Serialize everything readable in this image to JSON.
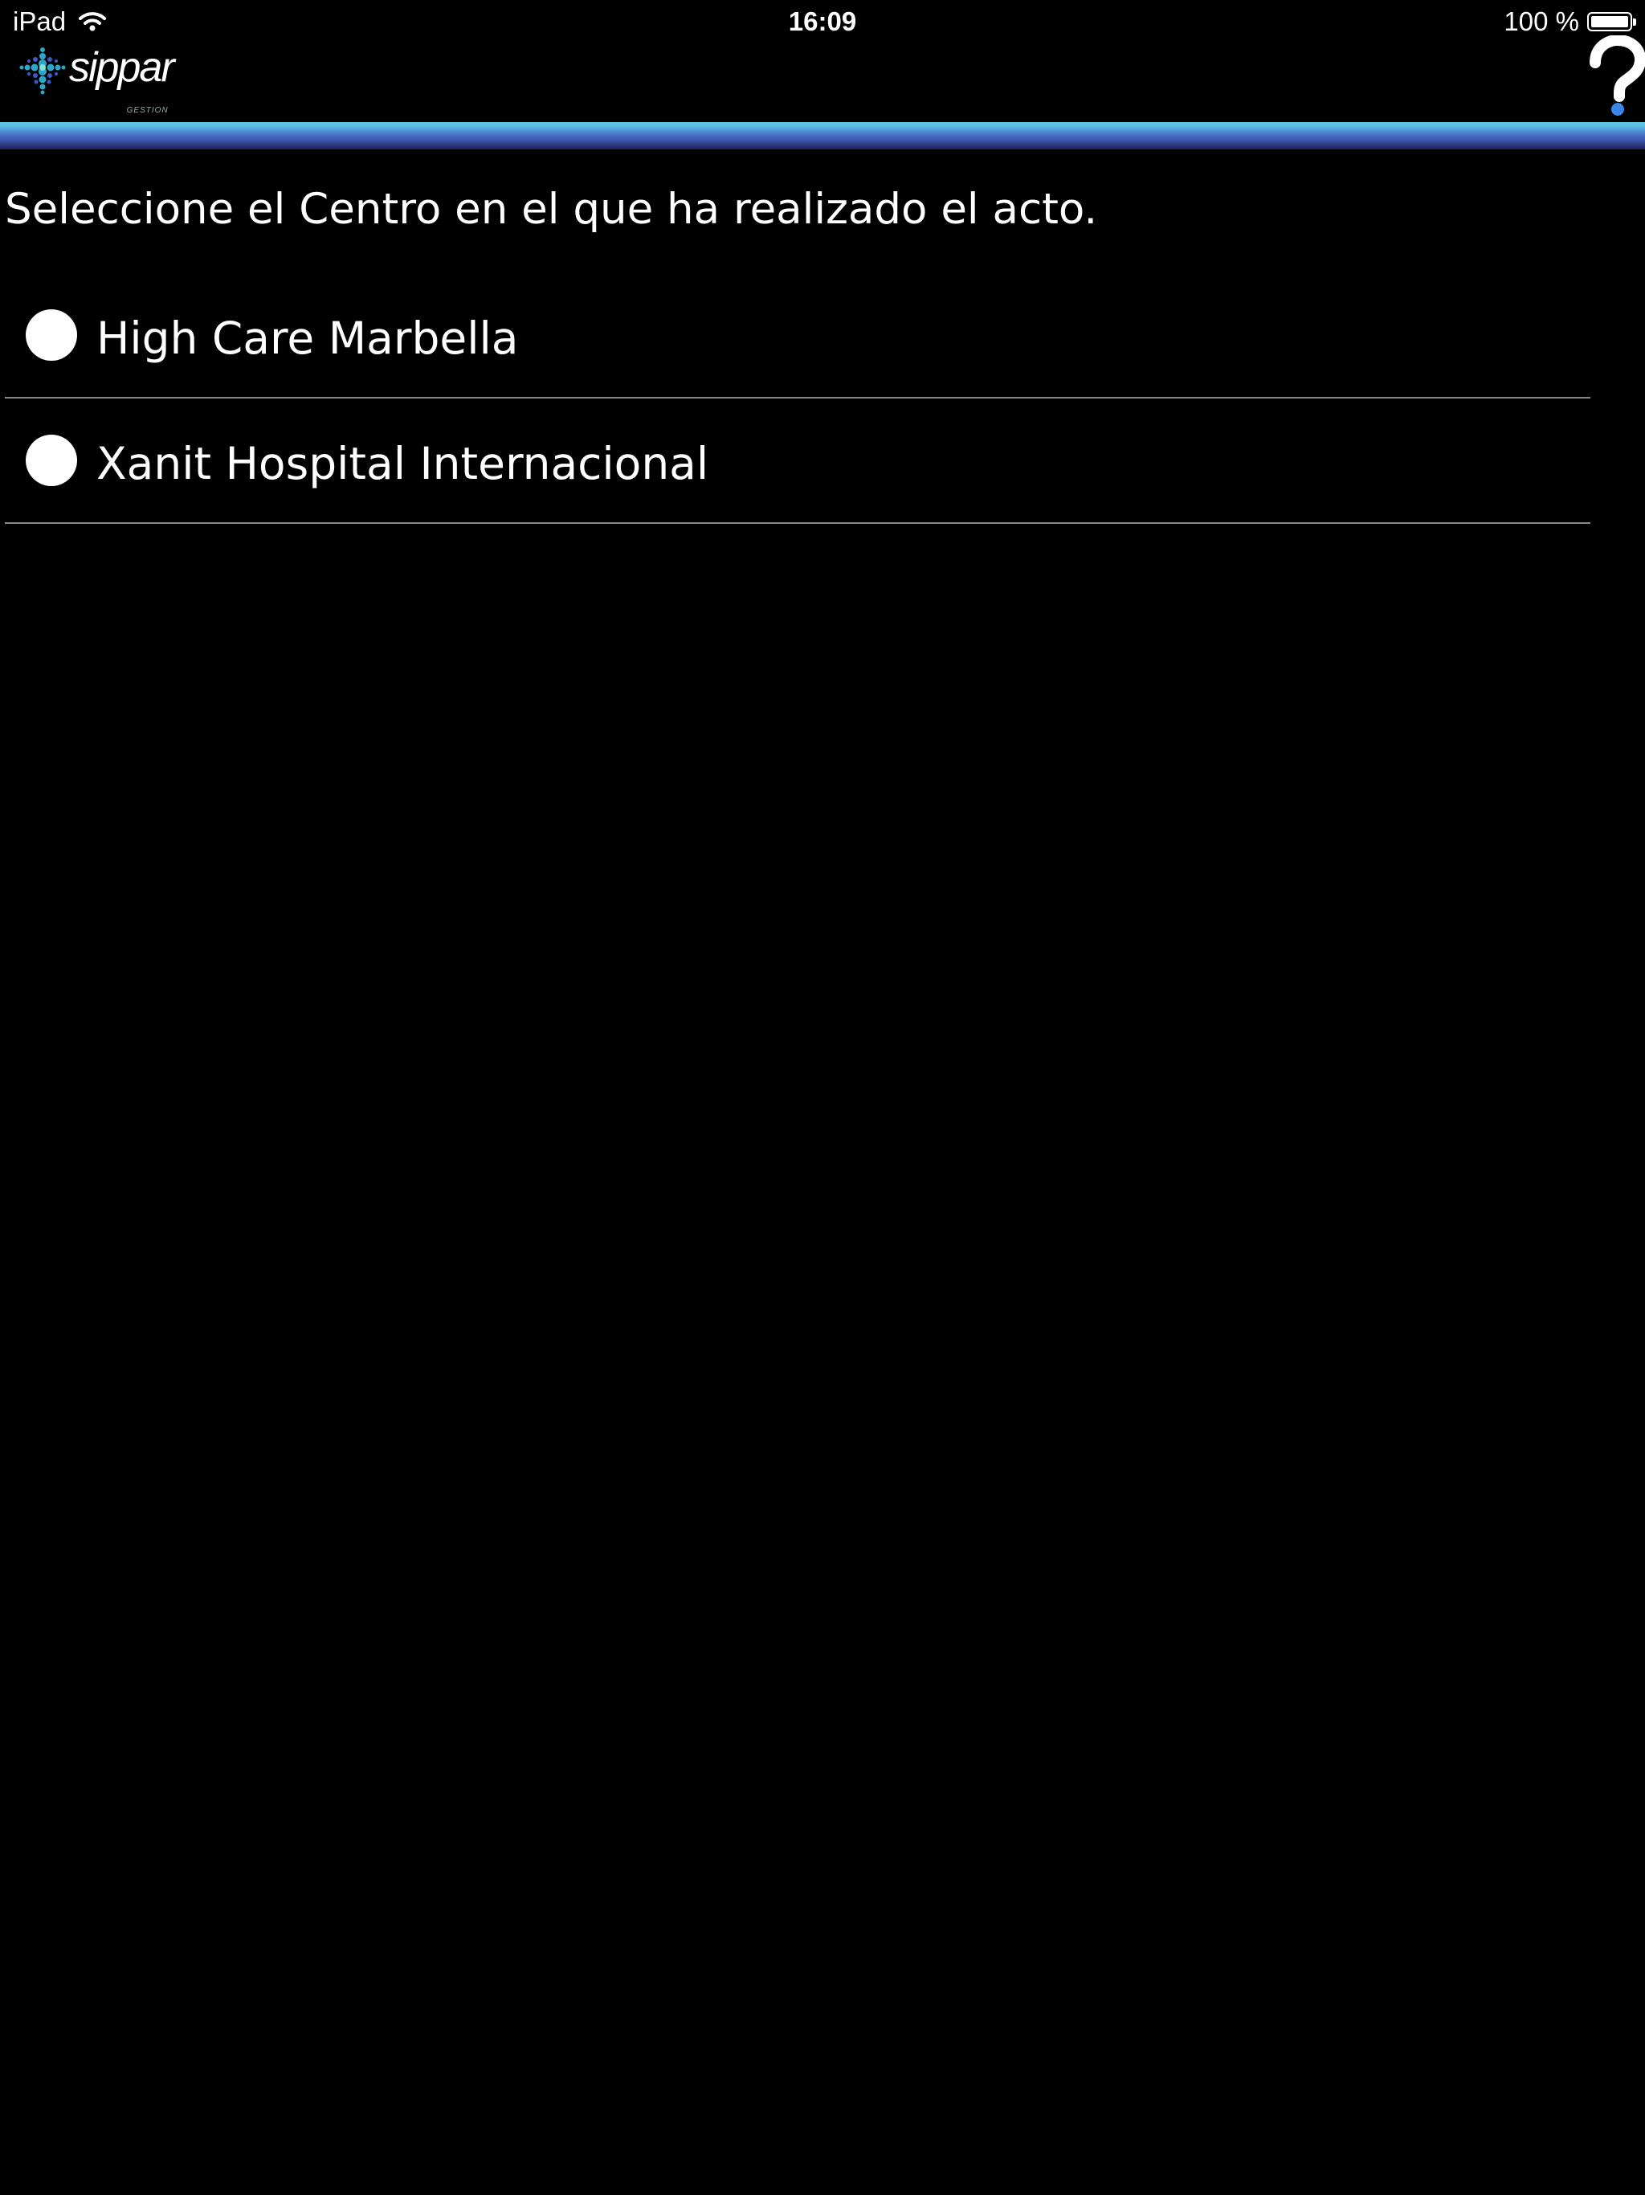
{
  "status_bar": {
    "device": "iPad",
    "time": "16:09",
    "battery": "100 %",
    "battery_level": 1.0
  },
  "header": {
    "logo_text": "sippar",
    "logo_subtext": "GESTION",
    "help_icon": "question-mark-icon",
    "accent_color": "#4b7fcf"
  },
  "main": {
    "prompt": "Seleccione el Centro en el que ha realizado el acto.",
    "options": [
      {
        "label": "High Care Marbella",
        "selected": false
      },
      {
        "label": "Xanit Hospital Internacional",
        "selected": false
      }
    ]
  }
}
